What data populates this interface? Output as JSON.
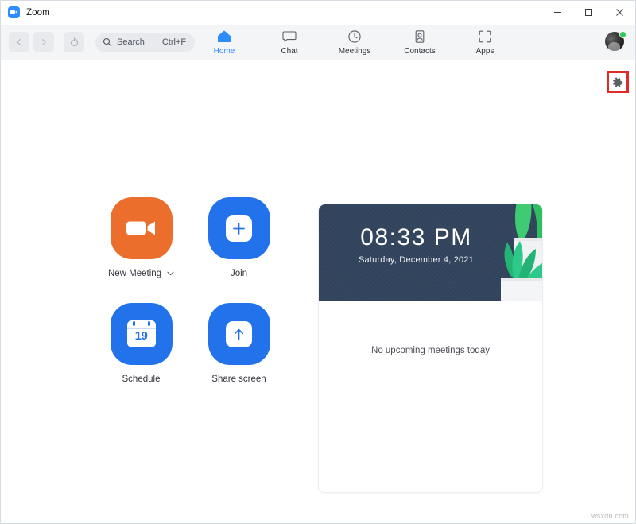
{
  "window": {
    "app_title": "Zoom",
    "logo_icon": "zoom-logo-icon",
    "controls": {
      "minimize": "minimize-icon",
      "maximize": "maximize-icon",
      "close": "close-icon"
    }
  },
  "navbar": {
    "back_icon": "chevron-left-icon",
    "forward_icon": "chevron-right-icon",
    "refresh_icon": "refresh-icon",
    "search": {
      "icon": "search-icon",
      "placeholder": "Search",
      "shortcut": "Ctrl+F"
    },
    "tabs": [
      {
        "label": "Home",
        "icon": "home-icon",
        "active": true
      },
      {
        "label": "Chat",
        "icon": "chat-icon",
        "active": false
      },
      {
        "label": "Meetings",
        "icon": "clock-icon",
        "active": false
      },
      {
        "label": "Contacts",
        "icon": "contacts-icon",
        "active": false
      },
      {
        "label": "Apps",
        "icon": "apps-icon",
        "active": false
      }
    ],
    "avatar": {
      "name": "user-avatar",
      "status": "available",
      "status_color": "#34C759"
    }
  },
  "content": {
    "settings": {
      "icon": "gear-icon",
      "highlight_color": "#E02B28",
      "highlighted": true
    },
    "actions": [
      {
        "label": "New Meeting",
        "icon": "video-camera-icon",
        "color": "#EC6E2D",
        "has_dropdown": true,
        "dropdown_icon": "chevron-down-icon"
      },
      {
        "label": "Join",
        "icon": "plus-icon",
        "color": "#2272EB",
        "has_dropdown": false
      },
      {
        "label": "Schedule",
        "icon": "calendar-icon",
        "color": "#2272EB",
        "calendar_day": "19",
        "has_dropdown": false
      },
      {
        "label": "Share screen",
        "icon": "up-arrow-icon",
        "color": "#2272EB",
        "has_dropdown": false
      }
    ],
    "meeting_card": {
      "time": "08:33 PM",
      "date": "Saturday, December 4, 2021",
      "banner_color": "#32445D",
      "illustration": "potted-plant-illustration",
      "empty_state": "No upcoming meetings today"
    }
  },
  "watermark": "wsxdn.com"
}
